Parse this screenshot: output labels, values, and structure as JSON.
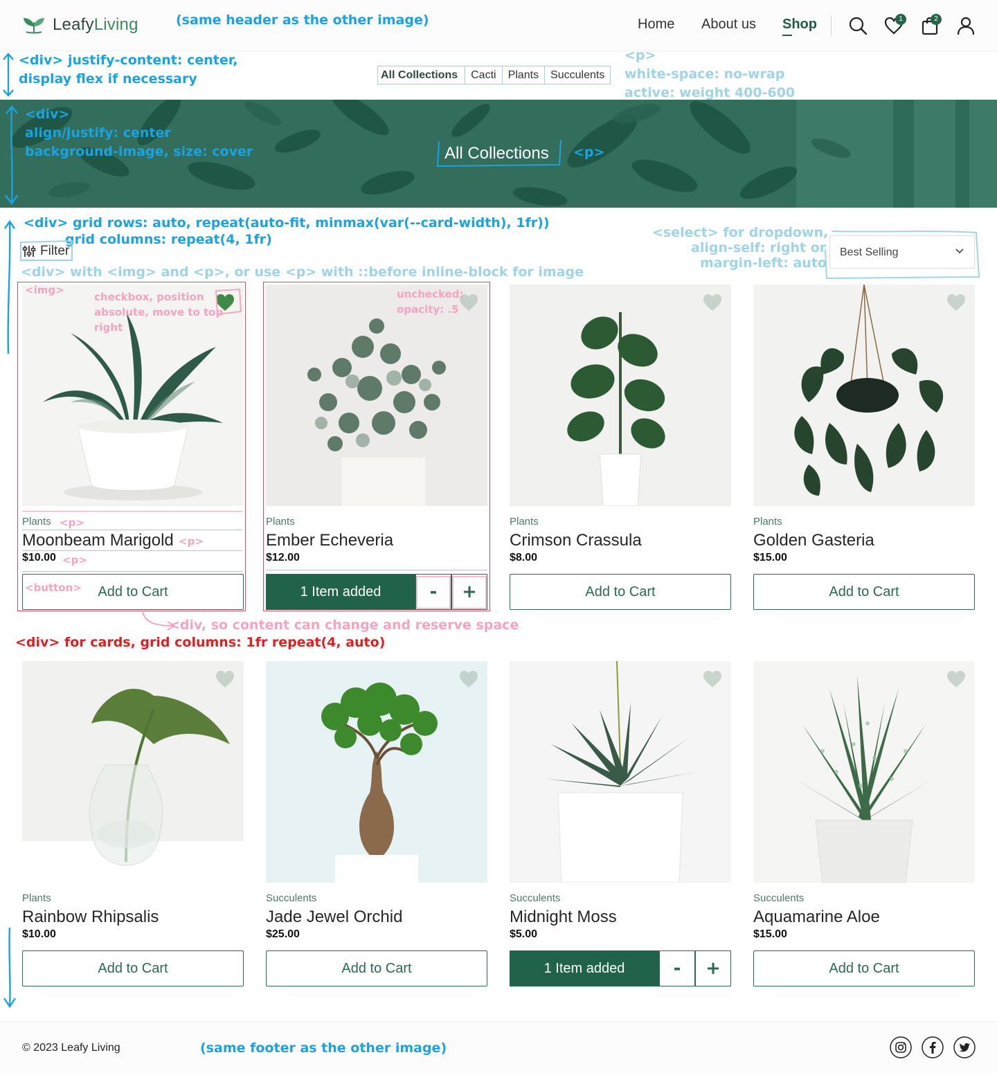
{
  "header": {
    "brand_part1": "Leafy",
    "brand_part2": "Living",
    "nav": {
      "home": "Home",
      "about": "About us",
      "shop": "Shop"
    },
    "favorites_count": "1",
    "cart_count": "2",
    "icons": [
      "search-icon",
      "heart-icon",
      "shopping-bag-icon",
      "user-icon"
    ]
  },
  "tabs": [
    "All Collections",
    "Cacti",
    "Plants",
    "Succulents"
  ],
  "active_tab": "All Collections",
  "hero": {
    "title": "All Collections"
  },
  "toolbar": {
    "filter_label": "Filter",
    "sort_value": "Best Selling"
  },
  "products": [
    {
      "category": "Plants",
      "name": "Moonbeam Marigold",
      "price": "$10.00",
      "favorited": true,
      "button": "Add to Cart"
    },
    {
      "category": "Plants",
      "name": "Ember Echeveria",
      "price": "$12.00",
      "favorited": false,
      "added_label": "1 Item added",
      "minus": "-",
      "plus": "+"
    },
    {
      "category": "Plants",
      "name": "Crimson Crassula",
      "price": "$8.00",
      "favorited": false,
      "button": "Add to Cart"
    },
    {
      "category": "Plants",
      "name": "Golden Gasteria",
      "price": "$15.00",
      "favorited": false,
      "button": "Add to Cart"
    },
    {
      "category": "Plants",
      "name": "Rainbow Rhipsalis",
      "price": "$10.00",
      "favorited": false,
      "button": "Add to Cart"
    },
    {
      "category": "Succulents",
      "name": "Jade Jewel Orchid",
      "price": "$25.00",
      "favorited": false,
      "button": "Add to Cart"
    },
    {
      "category": "Succulents",
      "name": "Midnight Moss",
      "price": "$5.00",
      "favorited": false,
      "added_label": "1 Item added",
      "minus": "-",
      "plus": "+"
    },
    {
      "category": "Succulents",
      "name": "Aquamarine Aloe",
      "price": "$15.00",
      "favorited": false,
      "button": "Add to Cart"
    }
  ],
  "footer": {
    "copyright": "© 2023 Leafy Living",
    "social": [
      "instagram-icon",
      "facebook-icon",
      "twitter-icon"
    ]
  },
  "annotations": {
    "header_note": "(same header as the other image)",
    "tabs_div_1": "<div> justify-content: center,",
    "tabs_div_2": "display flex if necessary",
    "tabs_p_1": "<p>",
    "tabs_p_2": "white-space: no-wrap",
    "tabs_p_3": "active: weight 400-600",
    "hero_1": "<div>",
    "hero_2": "align/justify: center",
    "hero_3": "background-image, size: cover",
    "hero_p": "<p>",
    "grid_1": "<div> grid rows: auto, repeat(auto-fit, minmax(var(--card-width), 1fr))",
    "grid_2": "grid columns: repeat(4, 1fr)",
    "select_1": "<select> for dropdown,",
    "select_2": "align-self: right or",
    "select_3": "margin-left: auto",
    "filter_note": "<div> with <img> and <p>, or use <p> with ::before inline-block for image",
    "img_tag": "<img>",
    "checkbox_1": "checkbox, position",
    "checkbox_2": "absolute, move to top",
    "checkbox_3": "right",
    "unchecked_1": "unchecked:",
    "unchecked_2": "opacity: .5",
    "p_tag_1": "<p>",
    "p_tag_2": "<p>",
    "p_tag_3": "<p>",
    "button_tag": "<button>",
    "reserve_note": "<div, so content can change and reserve space",
    "cards_note": "<div> for cards, grid columns: 1fr repeat(4, auto)",
    "footer_note": "(same footer as the other image)"
  },
  "colors": {
    "brand_dark": "#21634a",
    "hero_bg": "#2f6a58",
    "annotation_blue": "#1aa3e3",
    "annotation_pink": "#f5a3c0",
    "annotation_red": "#e02020"
  }
}
